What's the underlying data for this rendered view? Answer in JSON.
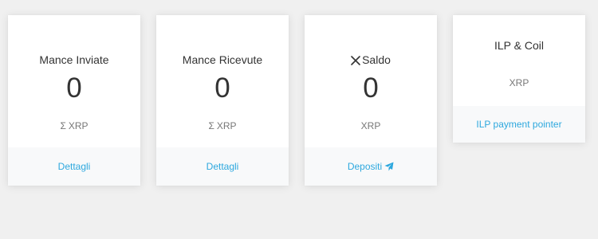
{
  "cards": [
    {
      "title": "Mance Inviate",
      "value": "0",
      "unit_prefix": "Σ",
      "unit": "XRP",
      "footer_label": "Dettagli"
    },
    {
      "title": "Mance Ricevute",
      "value": "0",
      "unit_prefix": "Σ",
      "unit": "XRP",
      "footer_label": "Dettagli"
    },
    {
      "title_icon": "xrp-icon",
      "title": "Saldo",
      "value": "0",
      "unit": "XRP",
      "footer_label": "Depositi",
      "footer_icon": "send-icon"
    },
    {
      "title": "ILP & Coil",
      "unit": "XRP",
      "footer_label": "ILP payment pointer"
    }
  ],
  "colors": {
    "link": "#2da8de",
    "background": "#f0f0f0",
    "card": "#ffffff",
    "footer": "#f8f9fa",
    "text": "#333333",
    "muted": "#777777"
  }
}
